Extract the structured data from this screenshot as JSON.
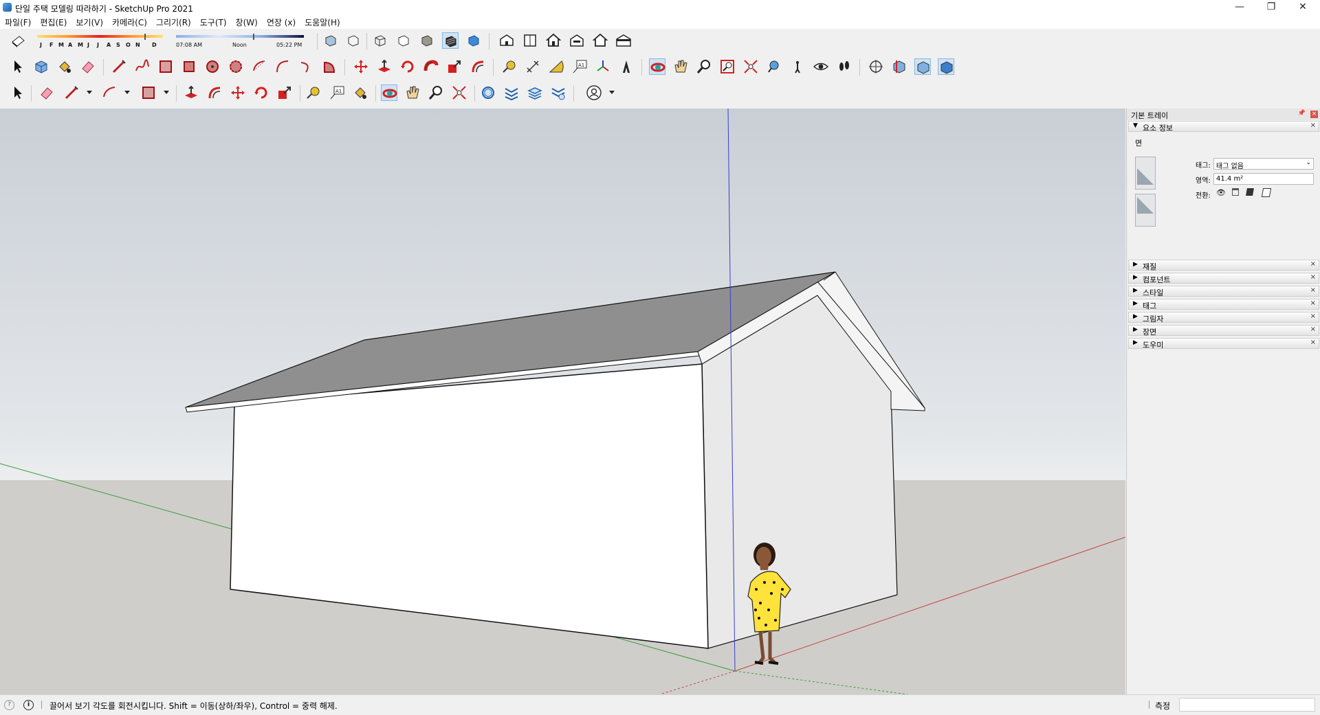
{
  "window": {
    "title": "단일 주택 모델링 따라하기 - SketchUp Pro 2021",
    "controls": [
      "—",
      "❐",
      "✕"
    ]
  },
  "menu": [
    "파일(F)",
    "편집(E)",
    "보기(V)",
    "카메라(C)",
    "그리기(R)",
    "도구(T)",
    "창(W)",
    "연장 (x)",
    "도움말(H)"
  ],
  "shadows": {
    "months": [
      "J",
      "F",
      "M",
      "A",
      "M",
      "J",
      "J",
      "A",
      "S",
      "O",
      "N",
      "D"
    ],
    "sunrise": "07:08 AM",
    "noon": "Noon",
    "sunset": "05:22 PM"
  },
  "status": {
    "message": "끌어서 보기 각도를 회전시킵니다. Shift = 이동(상하/좌우), Control = 중력 해제.",
    "measure_label": "측정",
    "measure_value": ""
  },
  "tray": {
    "title": "기본 트레이",
    "entity_info": {
      "header": "요소 정보",
      "entity_type": "면",
      "tag_label": "태그:",
      "tag_value": "태그 없음",
      "area_label": "영역:",
      "area_value": "41.4 m²",
      "toggle_label": "전환:"
    },
    "panels": [
      "재질",
      "컴포넌트",
      "스타일",
      "태그",
      "그림자",
      "장면",
      "도우미"
    ]
  },
  "colors": {
    "sky_top": "#c9cfd6",
    "ground": "#cfceca",
    "roof": "#8f8f8f",
    "wall_front": "#ffffff",
    "wall_side": "#e8e8e8",
    "axis_red": "#c84040",
    "axis_green": "#3a9a3a",
    "axis_blue": "#3a3acc"
  }
}
